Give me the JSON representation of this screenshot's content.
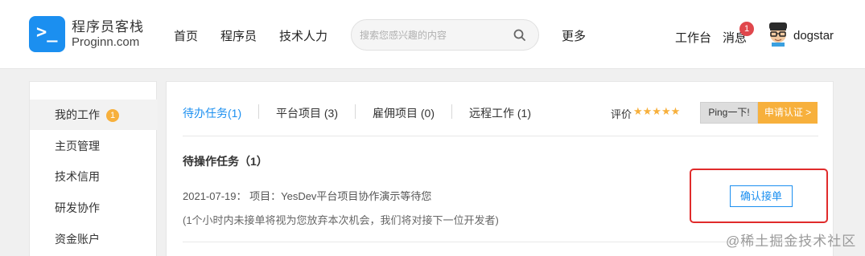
{
  "header": {
    "logo_text_cn": "程序员客栈",
    "logo_text_en": "Proginn.com",
    "logo_glyph": ">_",
    "nav": [
      "首页",
      "程序员",
      "技术人力"
    ],
    "search_placeholder": "搜索您感兴趣的内容",
    "more": "更多",
    "workbench": "工作台",
    "messages": "消息",
    "message_count": "1",
    "username": "dogstar"
  },
  "sidebar": {
    "items": [
      {
        "label": "我的工作",
        "badge": "1"
      },
      {
        "label": "主页管理"
      },
      {
        "label": "技术信用"
      },
      {
        "label": "研发协作"
      },
      {
        "label": "资金账户"
      }
    ]
  },
  "main": {
    "tabs": [
      "待办任务(1)",
      "平台项目 (3)",
      "雇佣项目 (0)",
      "远程工作 (1)"
    ],
    "rating_label": "评价",
    "stars": "★★★★★",
    "ping_button": "Ping一下!",
    "cert_button": "申请认证 >",
    "section_title": "待操作任务（1）",
    "task_text": "2021-07-19： 项目：YesDev平台项目协作演示等待您",
    "task_note": "(1个小时内未接单将视为您放弃本次机会，我们将对接下一位开发者)",
    "confirm_button": "确认接单"
  },
  "watermark": "@稀土掘金技术社区",
  "colors": {
    "brand_blue": "#1b8ff0",
    "accent_orange": "#f7b03c",
    "badge_red": "#e0474c",
    "highlight_red": "#e02b2b"
  }
}
